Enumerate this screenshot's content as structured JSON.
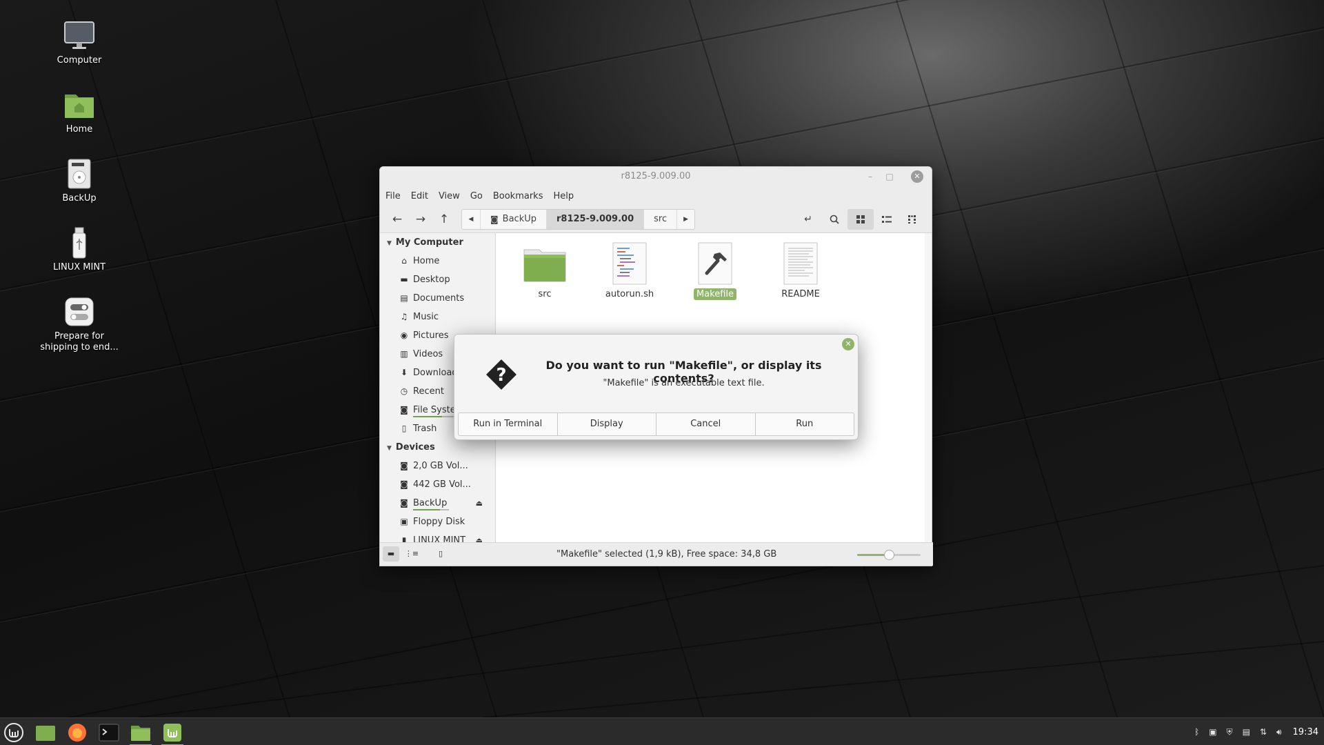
{
  "desktop": {
    "icons": [
      {
        "label": "Computer",
        "icon": "monitor-icon"
      },
      {
        "label": "Home",
        "icon": "home-folder-icon"
      },
      {
        "label": "BackUp",
        "icon": "drive-icon"
      },
      {
        "label": "LINUX MINT",
        "icon": "usb-drive-icon"
      },
      {
        "label": "Prepare for shipping to end...",
        "icon": "toggle-settings-icon"
      }
    ]
  },
  "window": {
    "title": "r8125-9.009.00",
    "menu": [
      "File",
      "Edit",
      "View",
      "Go",
      "Bookmarks",
      "Help"
    ],
    "breadcrumbs": [
      "BackUp",
      "r8125-9.009.00",
      "src"
    ],
    "active_crumb": "r8125-9.009.00",
    "sidebar": {
      "my_computer": "My Computer",
      "items": [
        {
          "label": "Home",
          "icon": "home-icon"
        },
        {
          "label": "Desktop",
          "icon": "desktop-icon"
        },
        {
          "label": "Documents",
          "icon": "documents-icon"
        },
        {
          "label": "Music",
          "icon": "music-icon"
        },
        {
          "label": "Pictures",
          "icon": "camera-icon"
        },
        {
          "label": "Videos",
          "icon": "film-icon"
        },
        {
          "label": "Downloads",
          "icon": "download-icon"
        },
        {
          "label": "Recent",
          "icon": "clock-icon"
        },
        {
          "label": "File System",
          "icon": "drive-icon",
          "usage": 0.6
        },
        {
          "label": "Trash",
          "icon": "trash-icon"
        }
      ],
      "devices": "Devices",
      "device_items": [
        {
          "label": "2,0 GB Vol...",
          "icon": "drive-icon"
        },
        {
          "label": "442 GB Vol...",
          "icon": "drive-icon"
        },
        {
          "label": "BackUp",
          "icon": "drive-icon",
          "usage": 0.75,
          "eject": true
        },
        {
          "label": "Floppy Disk",
          "icon": "floppy-icon"
        },
        {
          "label": "LINUX MINT",
          "icon": "usb-icon",
          "eject": true
        }
      ]
    },
    "files": [
      {
        "name": "src",
        "type": "folder"
      },
      {
        "name": "autorun.sh",
        "type": "script"
      },
      {
        "name": "Makefile",
        "type": "makefile",
        "selected": true
      },
      {
        "name": "README",
        "type": "text"
      }
    ],
    "status": "\"Makefile\" selected (1,9 kB), Free space: 34,8 GB",
    "zoom_level": 0.5
  },
  "dialog": {
    "title": "Do you want to run \"Makefile\", or display its contents?",
    "subtitle": "\"Makefile\" is an executable text file.",
    "buttons": [
      "Run in Terminal",
      "Display",
      "Cancel",
      "Run"
    ]
  },
  "taskbar": {
    "clock": "19:34"
  },
  "colors": {
    "accent": "#8fb46a",
    "folder": "#7fae4e"
  }
}
